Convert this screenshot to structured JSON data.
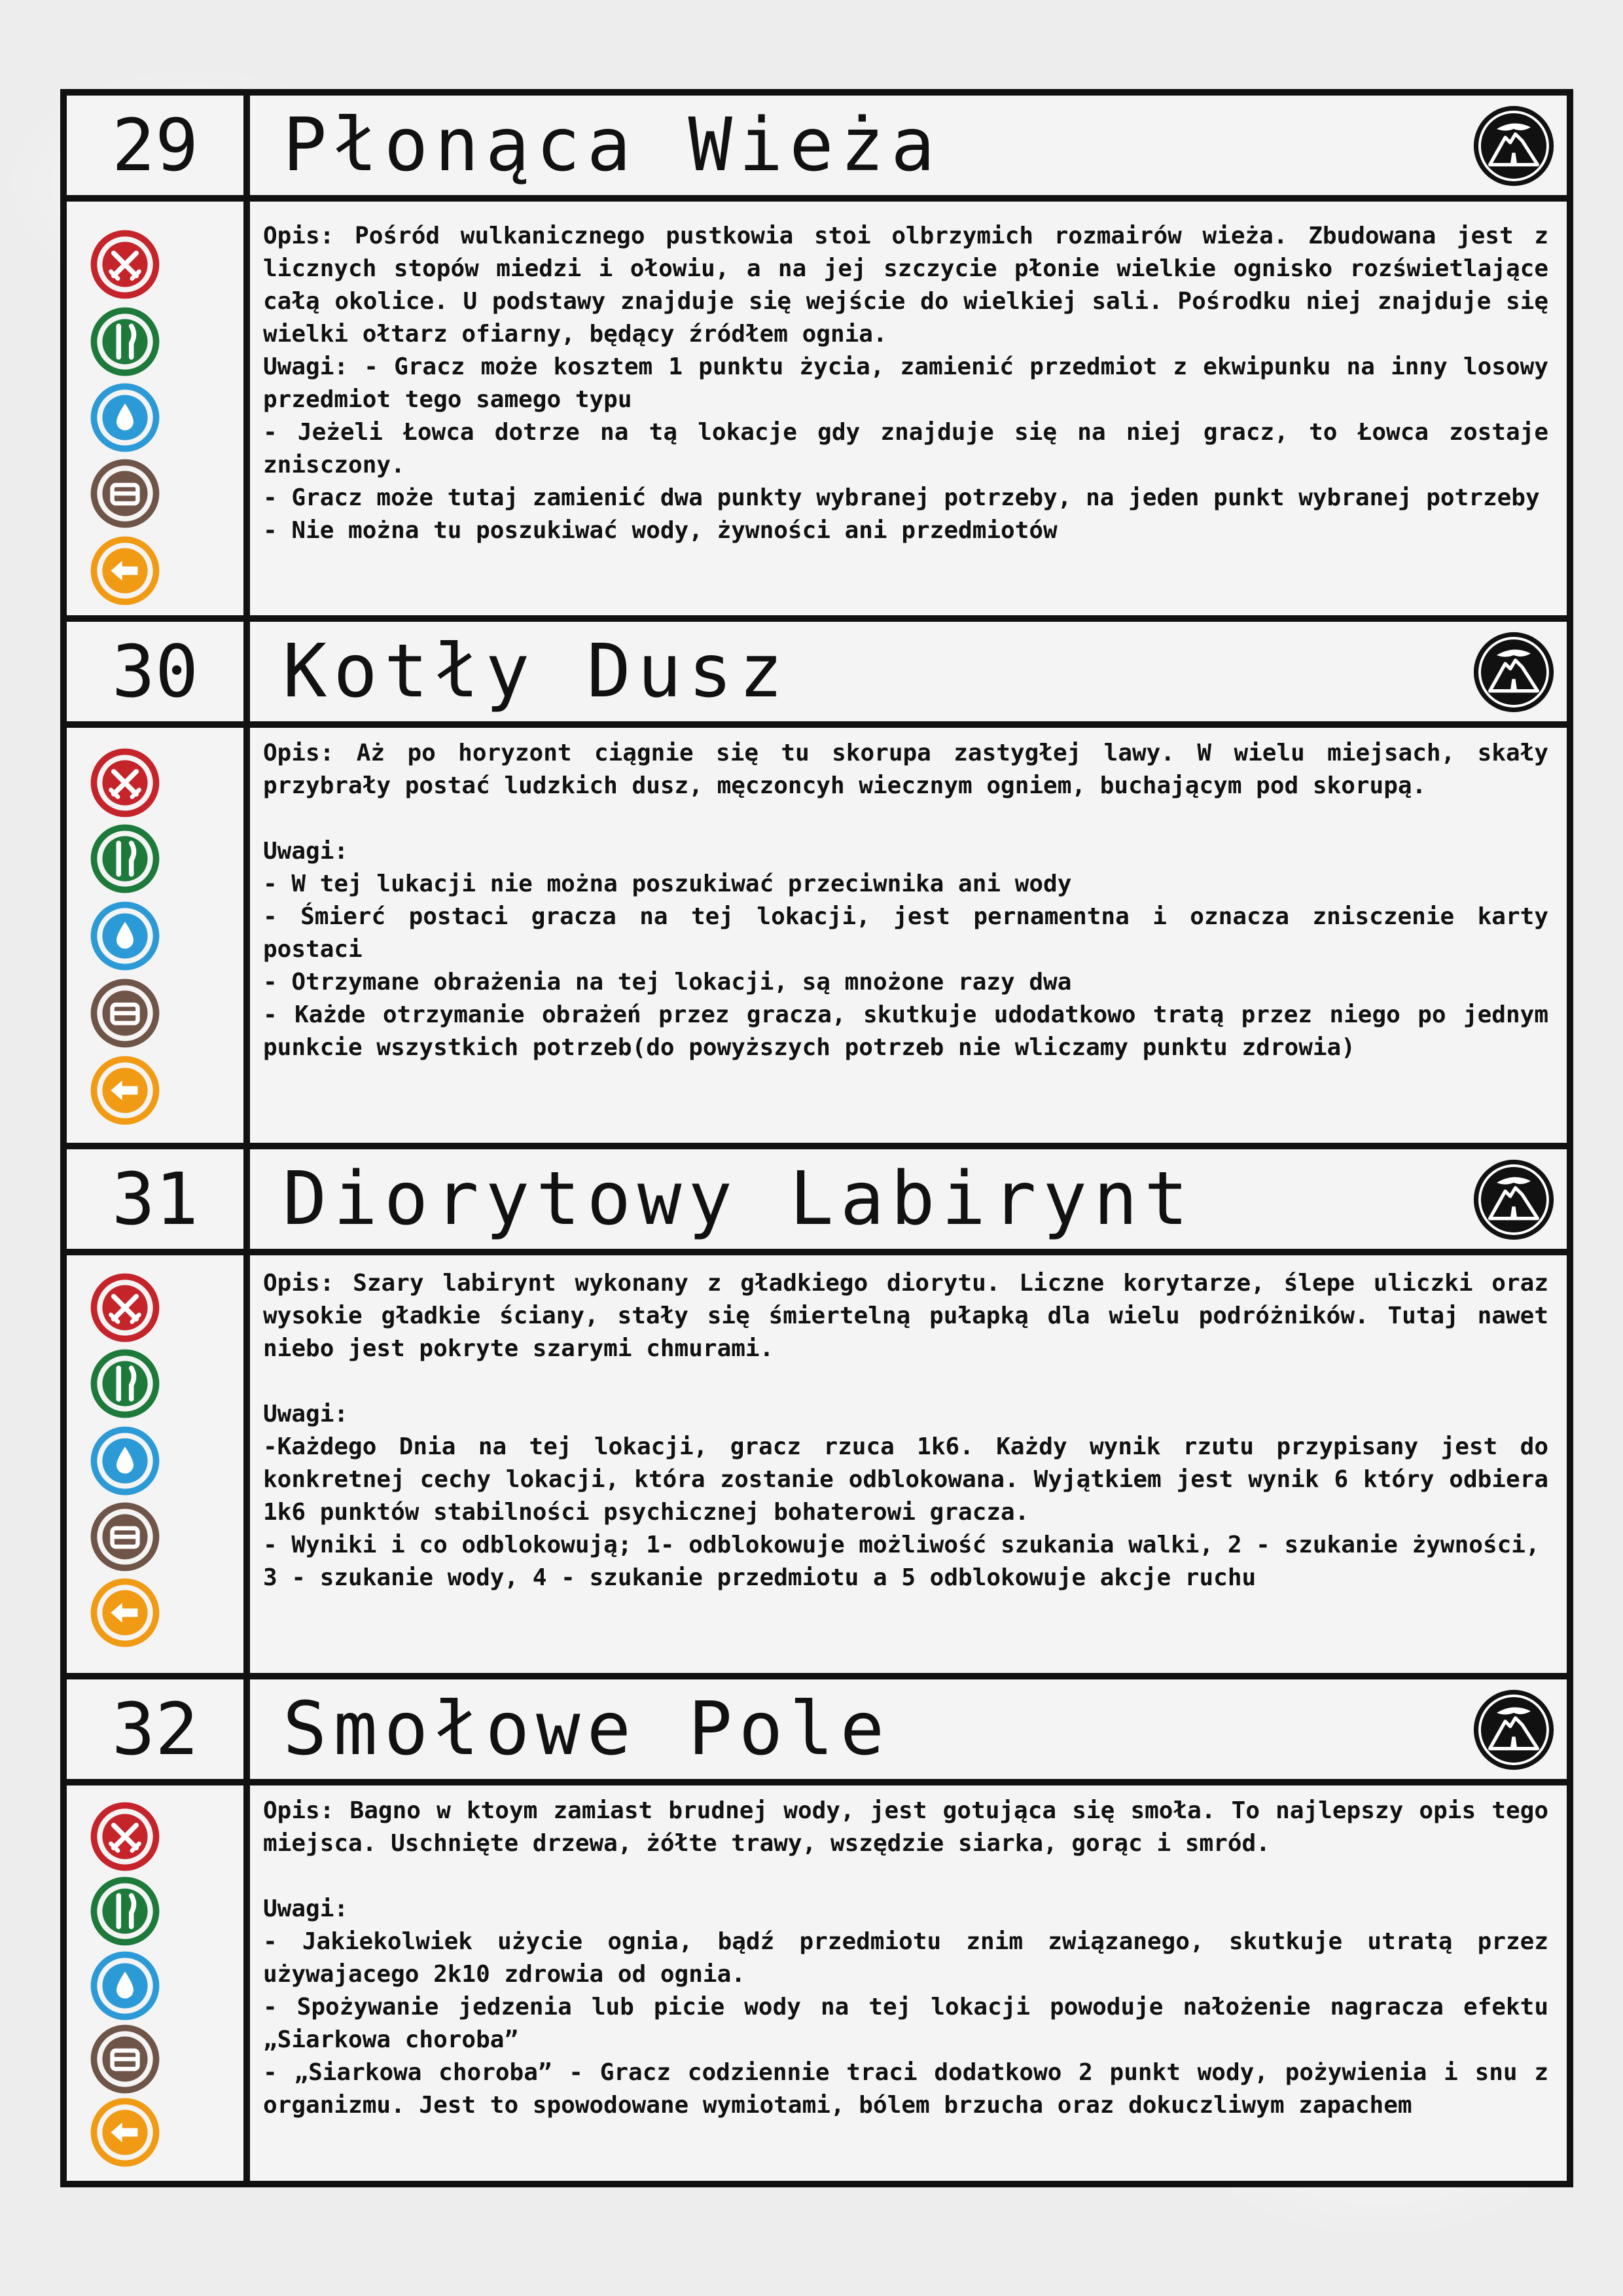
{
  "icons": {
    "combat": {
      "name": "combat-icon",
      "color": "#c4242a"
    },
    "food": {
      "name": "food-icon",
      "color": "#1d7a3a"
    },
    "water": {
      "name": "water-icon",
      "color": "#2c9ad6"
    },
    "sleep": {
      "name": "sleep-icon",
      "color": "#6f5448"
    },
    "move": {
      "name": "move-icon",
      "color": "#f19a14"
    },
    "volcano": {
      "name": "volcano-icon",
      "color": "#111111"
    }
  },
  "locations": [
    {
      "number": "29",
      "title": "Płonąca Wieża",
      "lines": [
        " Opis: Pośród wulkanicznego pustkowia stoi olbrzymich rozmairów wieża. Zbudowana jest z licznych stopów miedzi i ołowiu, a na jej szczycie płonie wielkie ognisko rozświetlające całą okolice. U podstawy znajduje się wejście do wielkiej sali. Pośrodku niej znajduje się wielki ołtarz ofiarny, będący źródłem ognia.",
        " Uwagi: - Gracz może kosztem 1 punktu życia, zamienić przedmiot z ekwipunku na inny losowy przedmiot tego samego typu",
        " - Jeżeli Łowca dotrze na tą lokacje gdy znajduje się na niej gracz, to Łowca zostaje znisczony.",
        " - Gracz może tutaj zamienić dwa punkty wybranej potrzeby, na jeden punkt wybranej potrzeby",
        " - Nie można tu poszukiwać wody, żywności ani przedmiotów"
      ]
    },
    {
      "number": "30",
      "title": "Kotły Dusz",
      "lines": [
        " Opis: Aż po horyzont ciągnie się tu skorupa zastygłej lawy. W wielu miejsach, skały przybrały postać ludzkich dusz, męczoncyh wiecznym ogniem, buchającym pod skorupą.",
        "",
        " Uwagi:",
        " - W tej lukacji nie można poszukiwać przeciwnika ani wody",
        " - Śmierć postaci gracza na tej lokacji, jest pernamentna i oznacza zniscze­nie karty postaci",
        " - Otrzymane obrażenia na tej lokacji, są mnożone razy dwa",
        " - Każde otrzymanie obrażeń przez gracza, skutkuje udodatkowo tratą przez niego po jednym punkcie wszystkich potrzeb(do powyższych potrzeb nie wliczamy punktu zdrowia)"
      ]
    },
    {
      "number": "31",
      "title": "Diorytowy Labirynt",
      "lines": [
        " Opis: Szary labirynt wykonany z gładkiego diorytu. Liczne korytarze, ślepe uliczki oraz wysokie gładkie ściany, stały się śmiertelną pułapką dla wielu podróżników. Tutaj nawet niebo jest pokryte szarymi chmurami.",
        "",
        " Uwagi:",
        " -Każdego Dnia na tej lokacji, gracz rzuca 1k6. Każdy wynik rzutu przypisany jest do konkretnej cechy lokacji, która zostanie odblokowana. Wyjątkiem jest wynik 6 który odbiera 1k6 punktów stabilności psychicznej bohaterowi gracza.",
        " - Wyniki i co odblokowują; 1- odblokowuje możliwość szukania walki, 2 - szukanie żywności,",
        " 3 - szukanie wody, 4 - szukanie przedmiotu a 5 odblokowuje akcje ruchu"
      ]
    },
    {
      "number": "32",
      "title": "Smołowe Pole",
      "lines": [
        " Opis: Bagno w ktoym zamiast brudnej wody, jest gotująca się smoła. To najlepszy opis tego miejsca. Uschnięte drzewa, żółte trawy, wszędzie siarka, gorąc i smród.",
        "",
        " Uwagi:",
        " - Jakiekolwiek użycie ognia, bądź przedmiotu  znim związanego, skutkuje utratą przez używajacego 2k10 zdrowia od ognia.",
        " - Spożywanie jedzenia lub picie wody na tej lokacji powoduje nałożenie nagracza efektu „Siarkowa choroba”",
        " - „Siarkowa choroba” - Gracz codziennie traci dodatkowo 2 punkt wody, pożywienia i snu z organizmu. Jest to spowodowane wymiotami, bólem brzucha oraz dokuczliwym zapachem"
      ]
    }
  ]
}
